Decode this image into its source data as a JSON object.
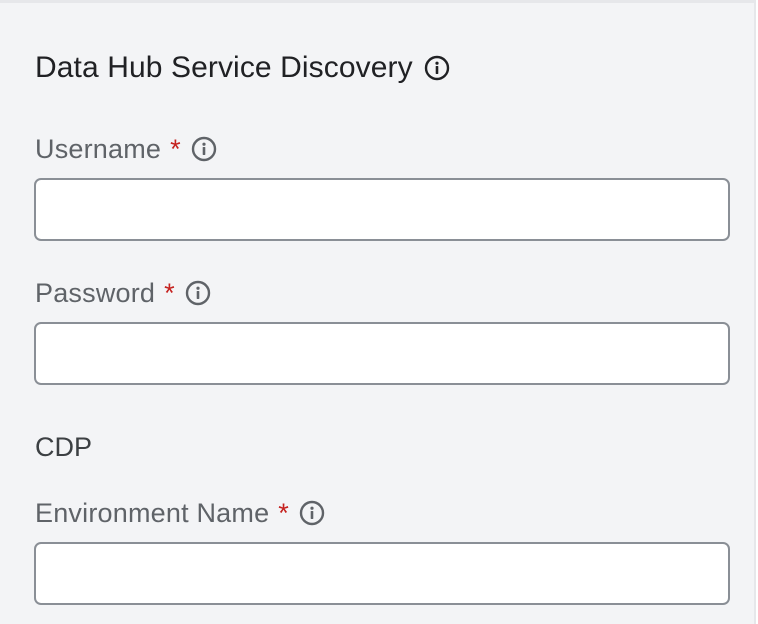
{
  "section": {
    "title": "Data Hub Service Discovery",
    "info_icon": "info-circle-icon"
  },
  "fields": {
    "username": {
      "label": "Username",
      "required_marker": "*",
      "value": "",
      "placeholder": ""
    },
    "password": {
      "label": "Password",
      "required_marker": "*",
      "value": "",
      "placeholder": ""
    },
    "environment_name": {
      "label": "Environment Name",
      "required_marker": "*",
      "value": "",
      "placeholder": ""
    }
  },
  "cdp": {
    "heading": "CDP"
  },
  "colors": {
    "panel_background": "#f3f4f6",
    "label_text": "#5f6368",
    "required_marker": "#c5221f",
    "input_border": "#8a8f96"
  }
}
